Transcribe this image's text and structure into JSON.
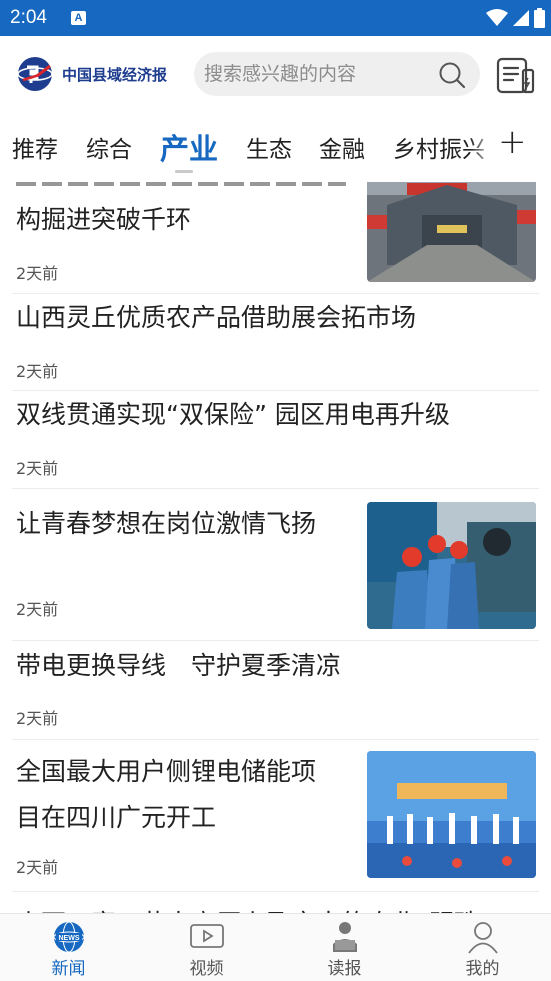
{
  "status_bar": {
    "time": "2:04",
    "notification_glyph": "A"
  },
  "header": {
    "logo_text": "中国县域经济报",
    "search": {
      "placeholder": "搜索感兴趣的内容"
    }
  },
  "tabs": [
    {
      "label": "推荐",
      "active": false
    },
    {
      "label": "综合",
      "active": false
    },
    {
      "label": "产业",
      "active": true
    },
    {
      "label": "生态",
      "active": false
    },
    {
      "label": "金融",
      "active": false
    },
    {
      "label": "乡村振兴",
      "active": false
    }
  ],
  "tab_more_glyph": "+",
  "feed": [
    {
      "title": "构掘进突破千环",
      "time": "2天前",
      "has_image": true,
      "image_icon": "tunnel-factory-photo"
    },
    {
      "title": "山西灵丘优质农产品借助展会拓市场",
      "time": "2天前",
      "has_image": false
    },
    {
      "title": "双线贯通实现“双保险” 园区用电再升级",
      "time": "2天前",
      "has_image": false
    },
    {
      "title": "让青春梦想在岗位激情飞扬",
      "time": "2天前",
      "has_image": true,
      "image_icon": "workers-helmets-photo"
    },
    {
      "title": "带电更换导线　守护夏季清凉",
      "time": "2天前",
      "has_image": false
    },
    {
      "title_lines": [
        "全国最大用户侧锂电储能项",
        "目在四川广元开工"
      ],
      "time": "2天前",
      "has_image": true,
      "image_icon": "ceremony-stage-photo"
    },
    {
      "title": "山西五寨：黄土高原上孕育出的农业“明珠”",
      "partial": true
    }
  ],
  "bottom_nav": [
    {
      "label": "新闻",
      "icon": "news-globe-icon",
      "active": true
    },
    {
      "label": "视频",
      "icon": "video-icon",
      "active": false
    },
    {
      "label": "读报",
      "icon": "reader-icon",
      "active": false
    },
    {
      "label": "我的",
      "icon": "profile-icon",
      "active": false
    }
  ],
  "colors": {
    "brand_blue": "#1668c1",
    "logo_navy": "#1e3d8f",
    "logo_red": "#d7262b"
  }
}
